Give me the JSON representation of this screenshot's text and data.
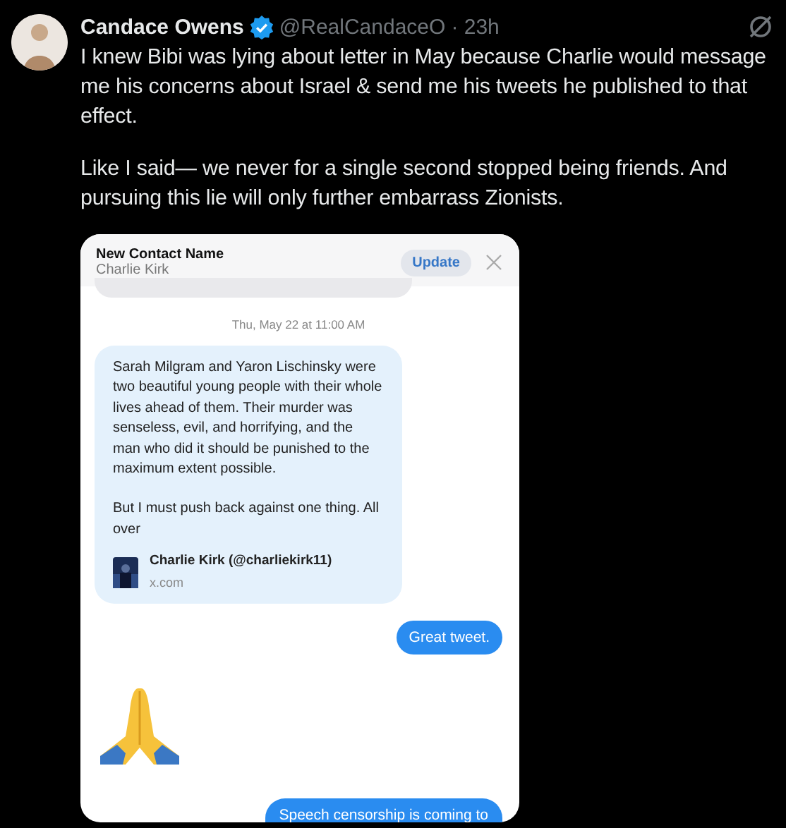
{
  "tweet": {
    "author": {
      "name": "Candace Owens",
      "verified": true,
      "handle": "@RealCandaceO",
      "time": "· 23h"
    },
    "paragraphs": [
      "I knew Bibi was lying about letter in May because Charlie would message me his concerns about Israel & send me his tweets he published to that effect.",
      "Like I said— we never for a single second stopped being friends. And pursuing this lie will only further embarrass Zionists."
    ],
    "attachment": {
      "header": {
        "title": "New Contact Name",
        "subtitle": "Charlie Kirk",
        "button": "Update"
      },
      "messages": [
        {
          "kind": "stub"
        },
        {
          "kind": "timestamp",
          "text": "Thu, May 22 at 11:00 AM"
        },
        {
          "kind": "incoming",
          "paragraphs": [
            "Sarah Milgram and Yaron Lischinsky were two beautiful young people with their whole lives ahead of them. Their murder was senseless, evil, and horrifying, and the man who did it should be punished to the maximum extent possible.",
            "But I must push back against one thing. All over"
          ],
          "link": {
            "title": "Charlie Kirk (@charliekirk11)",
            "domain": "x.com"
          }
        },
        {
          "kind": "outgoing",
          "text": "Great tweet."
        },
        {
          "kind": "emoji"
        },
        {
          "kind": "outgoing",
          "text": "Speech censorship is coming to"
        }
      ]
    }
  }
}
